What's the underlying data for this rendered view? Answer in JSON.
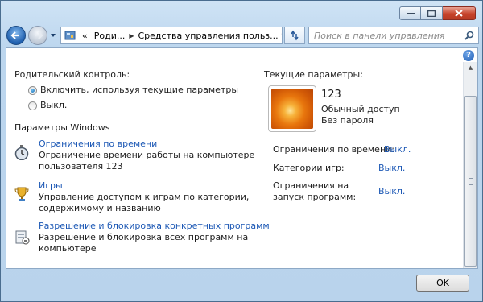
{
  "window": {
    "address": {
      "overflow": "«",
      "crumbs": [
        "Роди...",
        "Средства управления польз..."
      ]
    },
    "search_placeholder": "Поиск в панели управления",
    "help_glyph": "?"
  },
  "parental": {
    "heading": "Родительский контроль:",
    "options": [
      {
        "label": "Включить, используя текущие параметры",
        "selected": true
      },
      {
        "label": "Выкл.",
        "selected": false
      }
    ]
  },
  "windows_settings": {
    "heading": "Параметры Windows",
    "items": [
      {
        "title": "Ограничения по времени",
        "desc": [
          "Ограничение времени работы на компьютере",
          "пользователя 123"
        ],
        "icon": "stopwatch-icon"
      },
      {
        "title": "Игры",
        "desc": [
          "Управление доступом к играм по категории,",
          "содержимому и названию"
        ],
        "icon": "trophy-icon"
      },
      {
        "title": "Разрешение и блокировка конкретных программ",
        "desc": [
          "Разрешение и блокировка всех программ на",
          "компьютере"
        ],
        "icon": "program-block-icon"
      }
    ]
  },
  "current": {
    "heading": "Текущие параметры:",
    "user_name": "123",
    "account_type": "Обычный доступ",
    "password": "Без пароля",
    "rows": [
      {
        "label": [
          "Ограничения по времени:"
        ],
        "value": "Выкл."
      },
      {
        "label": [
          "Категории игр:"
        ],
        "value": "Выкл."
      },
      {
        "label": [
          "Ограничения на",
          "запуск программ:"
        ],
        "value": "Выкл."
      }
    ]
  },
  "footer": {
    "ok_label": "OK"
  },
  "colors": {
    "link": "#1c58b5",
    "close": "#c7432b"
  }
}
